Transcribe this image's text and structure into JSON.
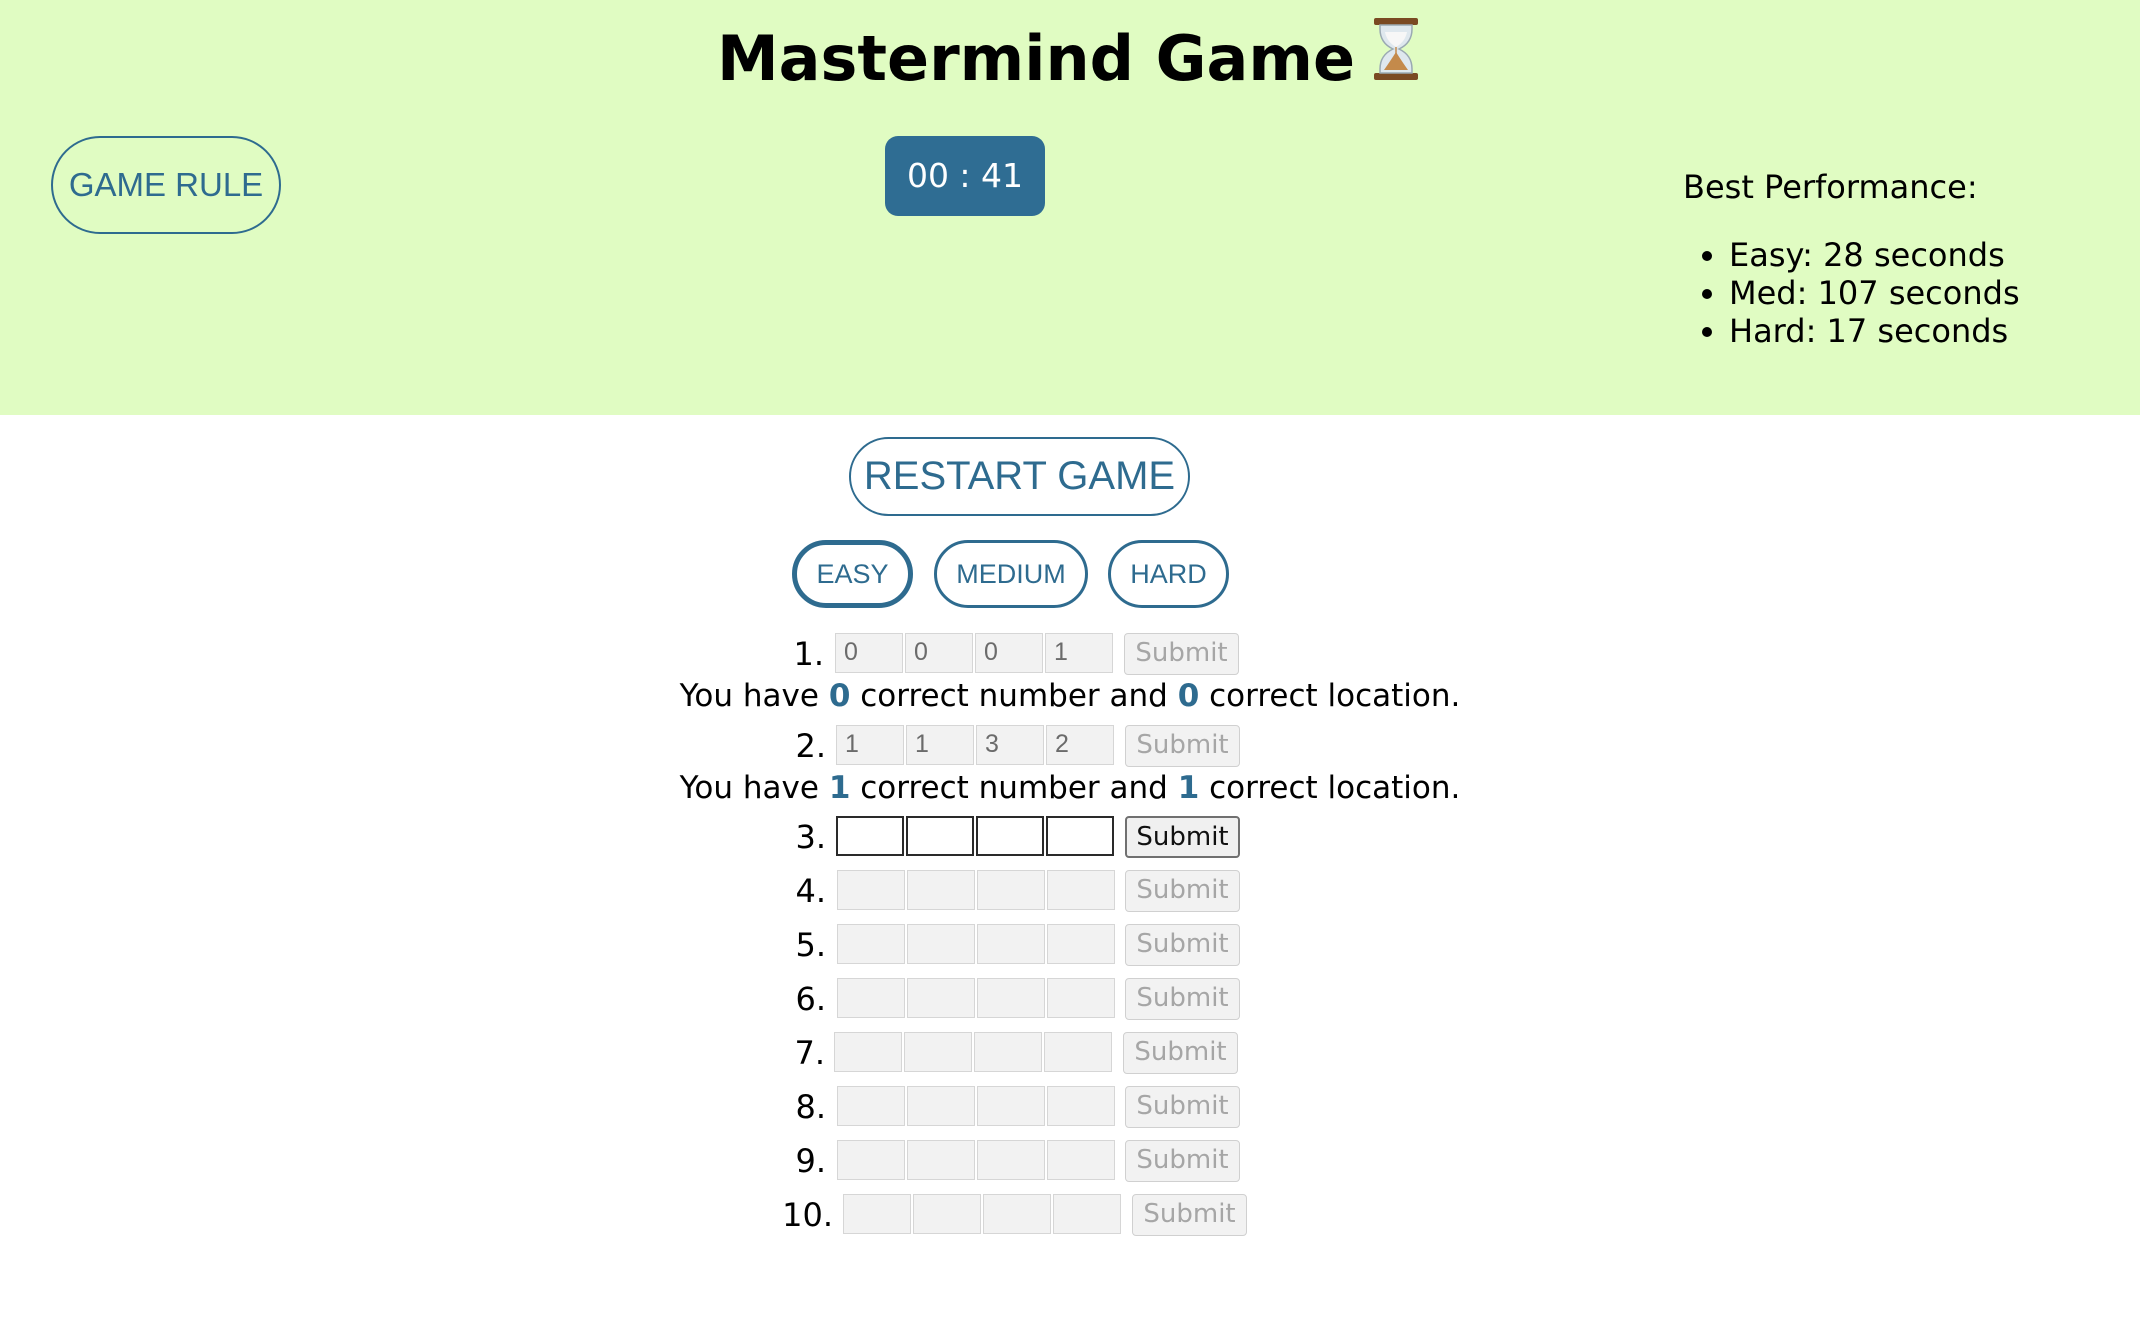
{
  "header": {
    "title": "Mastermind Game",
    "title_icon": "hourglass-icon",
    "game_rule_label": "GAME RULE",
    "timer": "00 : 41",
    "best_title": "Best Performance:",
    "best": [
      "Easy: 28 seconds",
      "Med: 107 seconds",
      "Hard: 17 seconds"
    ]
  },
  "controls": {
    "restart_label": "RESTART GAME",
    "levels": [
      "EASY",
      "MEDIUM",
      "HARD"
    ],
    "selected_level": "EASY"
  },
  "board": {
    "submit_label": "Submit",
    "rows": [
      {
        "num": "1.",
        "values": [
          "0",
          "0",
          "0",
          "1"
        ],
        "state": "done",
        "feedback": {
          "prefix": "You have",
          "numbers": "0",
          "mid": "correct number and",
          "locations": "0",
          "suffix": "correct location."
        }
      },
      {
        "num": "2.",
        "values": [
          "1",
          "1",
          "3",
          "2"
        ],
        "state": "done",
        "feedback": {
          "prefix": "You have",
          "numbers": "1",
          "mid": "correct number and",
          "locations": "1",
          "suffix": "correct location."
        }
      },
      {
        "num": "3.",
        "values": [
          "",
          "",
          "",
          ""
        ],
        "state": "active"
      },
      {
        "num": "4.",
        "values": [
          "",
          "",
          "",
          ""
        ],
        "state": "locked"
      },
      {
        "num": "5.",
        "values": [
          "",
          "",
          "",
          ""
        ],
        "state": "locked"
      },
      {
        "num": "6.",
        "values": [
          "",
          "",
          "",
          ""
        ],
        "state": "locked"
      },
      {
        "num": "7.",
        "values": [
          "",
          "",
          "",
          ""
        ],
        "state": "locked"
      },
      {
        "num": "8.",
        "values": [
          "",
          "",
          "",
          ""
        ],
        "state": "locked"
      },
      {
        "num": "9.",
        "values": [
          "",
          "",
          "",
          ""
        ],
        "state": "locked"
      },
      {
        "num": "10.",
        "values": [
          "",
          "",
          "",
          ""
        ],
        "state": "locked"
      }
    ]
  },
  "colors": {
    "header_bg": "#e0fcc2",
    "accent": "#2e6b8f",
    "timer_bg": "#2f6d93"
  }
}
